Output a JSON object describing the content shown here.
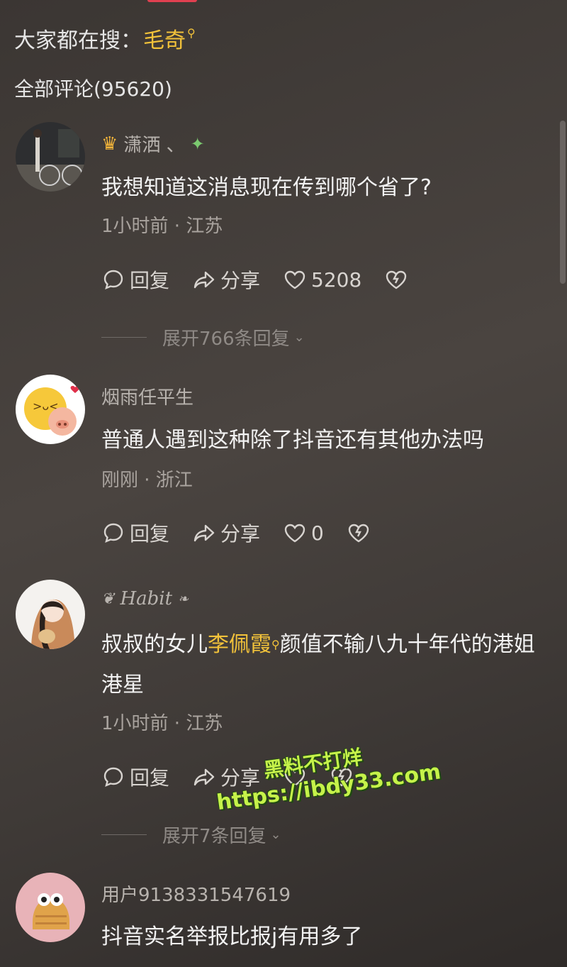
{
  "search": {
    "prefix": "大家都在搜：",
    "keyword": "毛奇"
  },
  "comments_header": "全部评论(95620)",
  "comments": [
    {
      "username": "潇洒 、",
      "text": "我想知道这消息现在传到哪个省了?",
      "meta": "1小时前 · 江苏",
      "reply_label": "回复",
      "share_label": "分享",
      "likes": "5208",
      "expand": "展开766条回复"
    },
    {
      "username": "烟雨任平生",
      "text": "普通人遇到这种除了抖音还有其他办法吗",
      "meta": "刚刚 · 浙江",
      "reply_label": "回复",
      "share_label": "分享",
      "likes": "0"
    },
    {
      "username": "Habit",
      "text_before": "叔叔的女儿",
      "mention": "李佩霞",
      "text_after": "颜值不输八九十年代的港姐港星",
      "meta": "1小时前 · 江苏",
      "reply_label": "回复",
      "share_label": "分享",
      "expand": "展开7条回复"
    },
    {
      "username": "用户9138331547619",
      "text": "抖音实名举报比报j有用多了"
    }
  ],
  "watermark": {
    "line1": "黑料不打烊",
    "line2": "https://ibdy33.com"
  },
  "colors": {
    "accent_yellow": "#f2c23a",
    "background": "#3f3a37",
    "watermark": "#c6f24a"
  }
}
